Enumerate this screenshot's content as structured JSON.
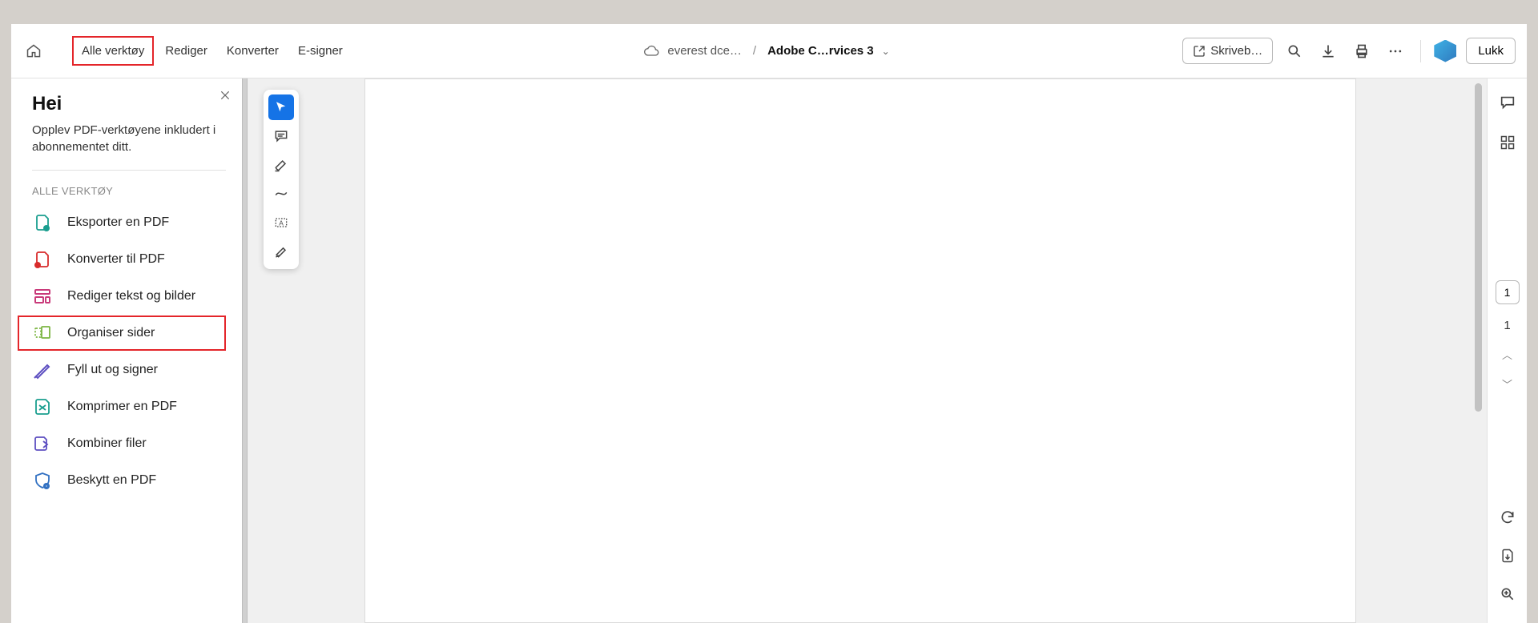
{
  "toolbar": {
    "tabs": [
      {
        "label": "Alle verktøy",
        "active": true,
        "highlighted": true
      },
      {
        "label": "Rediger"
      },
      {
        "label": "Konverter"
      },
      {
        "label": "E-signer"
      }
    ],
    "cloud_location": "everest dce…",
    "file_name": "Adobe C…rvices 3",
    "desktop_button": "Skriveb…",
    "close_button": "Lukk"
  },
  "sidebar": {
    "title": "Hei",
    "subtitle": "Opplev PDF-verktøyene inkludert i abonnementet ditt.",
    "section_label": "ALLE VERKTØY",
    "tools": [
      {
        "label": "Eksporter en PDF",
        "icon": "export-pdf"
      },
      {
        "label": "Konverter til PDF",
        "icon": "convert-pdf"
      },
      {
        "label": "Rediger tekst og bilder",
        "icon": "edit-text"
      },
      {
        "label": "Organiser sider",
        "icon": "organize",
        "highlighted": true
      },
      {
        "label": "Fyll ut og signer",
        "icon": "fill-sign"
      },
      {
        "label": "Komprimer en PDF",
        "icon": "compress"
      },
      {
        "label": "Kombiner filer",
        "icon": "combine"
      },
      {
        "label": "Beskytt en PDF",
        "icon": "protect"
      }
    ]
  },
  "quicktools": [
    {
      "name": "select",
      "active": true
    },
    {
      "name": "comment"
    },
    {
      "name": "highlight"
    },
    {
      "name": "draw"
    },
    {
      "name": "textbox"
    },
    {
      "name": "sign"
    }
  ],
  "right_rail": {
    "page_number": "1",
    "total_pages": "1"
  }
}
